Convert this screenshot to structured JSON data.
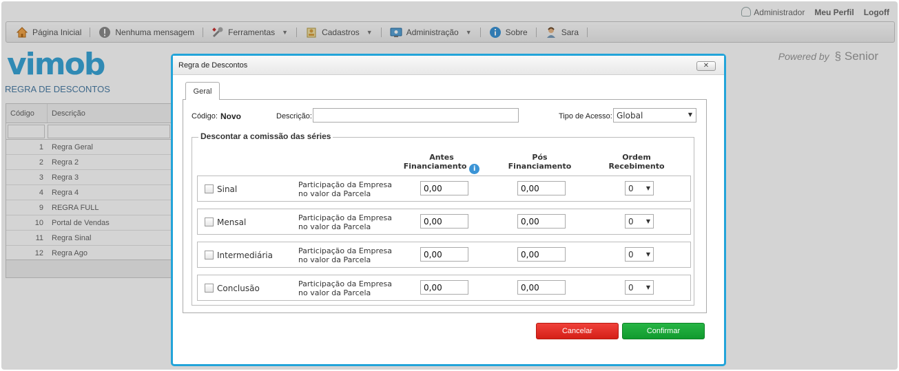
{
  "userbar": {
    "user": "Administrador",
    "profile": "Meu Perfil",
    "logoff": "Logoff"
  },
  "nav": {
    "items": [
      {
        "label": "Página Inicial",
        "icon": "home-icon"
      },
      {
        "label": "Nenhuma mensagem",
        "icon": "alert-icon"
      },
      {
        "label": "Ferramentas",
        "icon": "tools-icon",
        "dropdown": true
      },
      {
        "label": "Cadastros",
        "icon": "register-icon",
        "dropdown": true
      },
      {
        "label": "Administração",
        "icon": "admin-icon",
        "dropdown": true
      },
      {
        "label": "Sobre",
        "icon": "info-icon"
      },
      {
        "label": "Sara",
        "icon": "assistant-icon"
      }
    ]
  },
  "brand": {
    "logo": "vimob",
    "page_title": "REGRA DE DESCONTOS",
    "powered_by": "Powered by",
    "vendor": "Senior"
  },
  "grid": {
    "columns": [
      "Código",
      "Descrição"
    ],
    "rows": [
      {
        "code": "1",
        "desc": "Regra Geral"
      },
      {
        "code": "2",
        "desc": "Regra 2"
      },
      {
        "code": "3",
        "desc": "Regra 3"
      },
      {
        "code": "4",
        "desc": "Regra 4"
      },
      {
        "code": "9",
        "desc": "REGRA FULL"
      },
      {
        "code": "10",
        "desc": "Portal de Vendas"
      },
      {
        "code": "11",
        "desc": "Regra Sinal"
      },
      {
        "code": "12",
        "desc": "Regra Ago"
      }
    ]
  },
  "modal": {
    "title": "Regra de Descontos",
    "close": "✕",
    "tab": "Geral",
    "codigo_label": "Código:",
    "codigo_value": "Novo",
    "descricao_label": "Descrição:",
    "descricao_value": "",
    "tipo_label": "Tipo de Acesso:",
    "tipo_value": "Global",
    "legend": "Descontar a comissão das séries",
    "col_antes_1": "Antes",
    "col_antes_2": "Financiamento",
    "col_pos_1": "Pós",
    "col_pos_2": "Financiamento",
    "col_ordem_1": "Ordem",
    "col_ordem_2": "Recebimento",
    "participacao_1": "Participação da Empresa",
    "participacao_2": "no valor da Parcela",
    "series": [
      {
        "name": "Sinal",
        "antes": "0,00",
        "pos": "0,00",
        "ordem": "0"
      },
      {
        "name": "Mensal",
        "antes": "0,00",
        "pos": "0,00",
        "ordem": "0"
      },
      {
        "name": "Intermediária",
        "antes": "0,00",
        "pos": "0,00",
        "ordem": "0"
      },
      {
        "name": "Conclusão",
        "antes": "0,00",
        "pos": "0,00",
        "ordem": "0"
      }
    ],
    "cancel": "Cancelar",
    "confirm": "Confirmar"
  },
  "colors": {
    "accent": "#22a4d9",
    "cancel": "#e0261e",
    "confirm": "#16a236"
  }
}
